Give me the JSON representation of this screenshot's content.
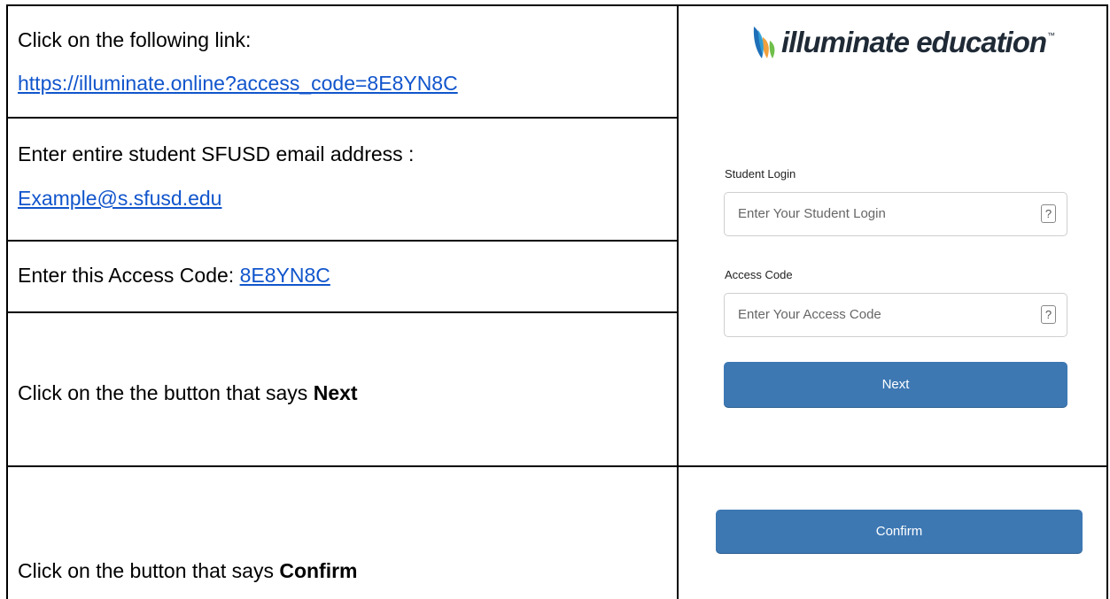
{
  "steps": {
    "step1": {
      "text": "Click on the following link:",
      "link": "https://illuminate.online?access_code=8E8YN8C"
    },
    "step2": {
      "text": "Enter entire student SFUSD email address :",
      "link": "Example@s.sfusd.edu"
    },
    "step3": {
      "text": "Enter this Access Code: ",
      "link": "8E8YN8C"
    },
    "step4": {
      "text": "Click on the the button that says ",
      "bold": "Next"
    },
    "step5": {
      "text": "Click on the button that says ",
      "bold": "Confirm"
    }
  },
  "login_form": {
    "logo_text": "illuminate education",
    "logo_tm": "™",
    "student_login_label": "Student Login",
    "student_login_placeholder": "Enter Your Student Login",
    "access_code_label": "Access Code",
    "access_code_placeholder": "Enter Your Access Code",
    "help_glyph": "?",
    "next_button": "Next",
    "confirm_button": "Confirm"
  },
  "colors": {
    "link": "#1155cc",
    "button": "#3d78b3",
    "border": "#000000"
  }
}
